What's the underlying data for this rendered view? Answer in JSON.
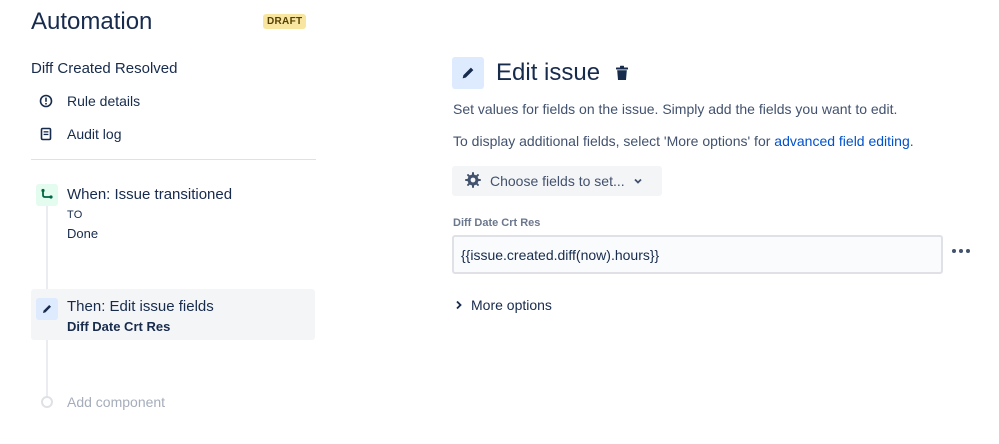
{
  "app": {
    "title": "Automation",
    "status_badge": "DRAFT"
  },
  "rule": {
    "name": "Diff Created Resolved"
  },
  "nav": {
    "rule_details": "Rule details",
    "audit_log": "Audit log"
  },
  "flow": {
    "trigger": {
      "title": "When: Issue transitioned",
      "sub_label": "TO",
      "sub_value": "Done",
      "icon": "branch-icon"
    },
    "action": {
      "title": "Then: Edit issue fields",
      "sub": "Diff Date Crt Res",
      "icon": "pencil-icon"
    },
    "add_component": "Add component"
  },
  "panel": {
    "heading": "Edit issue",
    "description": "Set values for fields on the issue. Simply add the fields you want to edit.",
    "additional_prefix": "To display additional fields, select 'More options' for ",
    "additional_link": "advanced field editing",
    "additional_suffix": ".",
    "choose_fields_label": "Choose fields to set...",
    "field": {
      "label": "Diff Date Crt Res",
      "value": "{{issue.created.diff(now).hours}}"
    },
    "more_options_label": "More options"
  },
  "colors": {
    "text": "#172b4d",
    "link": "#0052cc",
    "draft_badge_bg": "#f8e6a0",
    "trigger_badge_bg": "#e3fcef",
    "action_badge_bg": "#deebff"
  }
}
